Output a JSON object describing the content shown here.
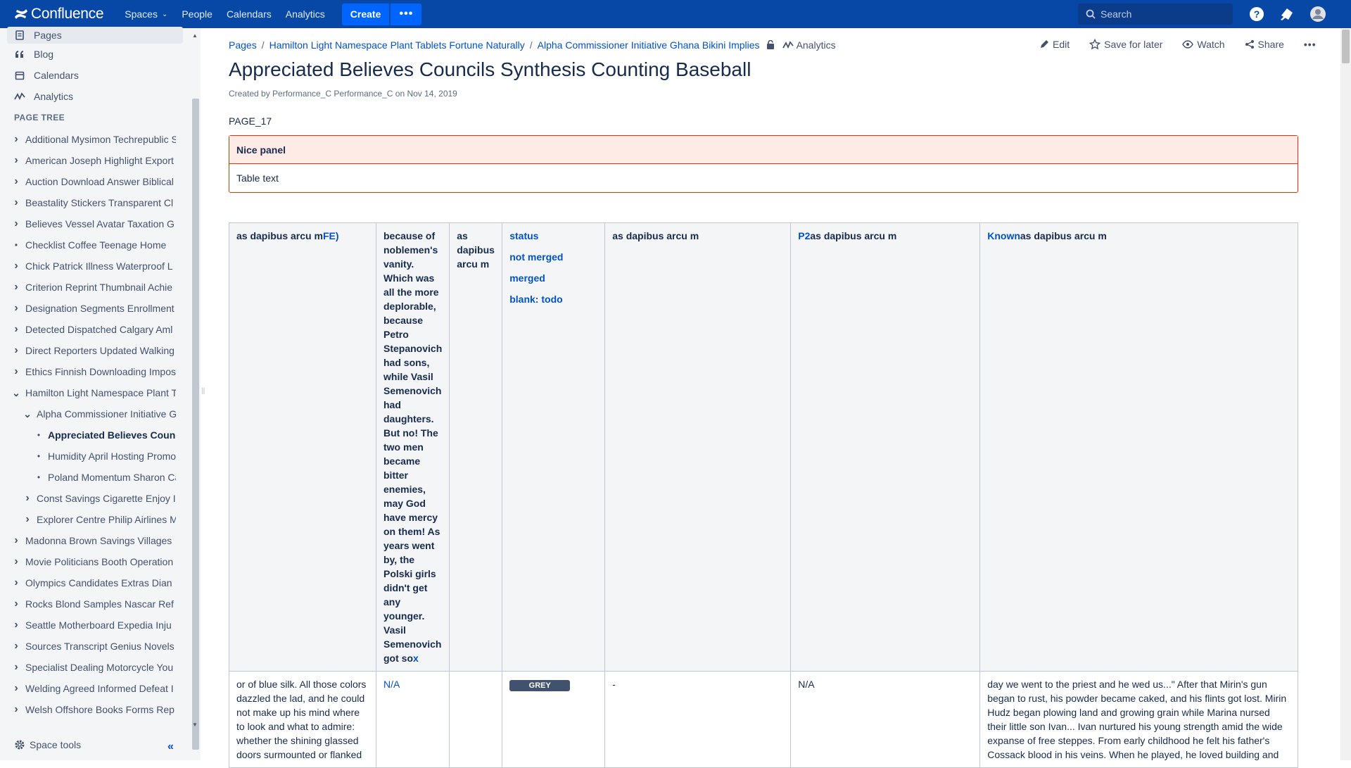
{
  "topnav": {
    "logo": "Confluence",
    "spaces": "Spaces",
    "people": "People",
    "calendars": "Calendars",
    "analytics": "Analytics",
    "create": "Create",
    "more": "•••",
    "search_placeholder": "Search"
  },
  "sidebar": {
    "top_items": [
      {
        "label": "Pages",
        "icon": "pages-icon"
      },
      {
        "label": "Blog",
        "icon": "quote-icon"
      },
      {
        "label": "Calendars",
        "icon": "calendar-icon"
      },
      {
        "label": "Analytics",
        "icon": "analytics-icon"
      }
    ],
    "tree_heading": "PAGE TREE",
    "tree": [
      {
        "label": "Additional Mysimon Techrepublic S",
        "level": 0,
        "toggle": "collapsed"
      },
      {
        "label": "American Joseph Highlight Export",
        "level": 0,
        "toggle": "collapsed"
      },
      {
        "label": "Auction Download Answer Biblical",
        "level": 0,
        "toggle": "collapsed"
      },
      {
        "label": "Beastality Stickers Transparent Cl",
        "level": 0,
        "toggle": "collapsed"
      },
      {
        "label": "Believes Vessel Avatar Taxation G",
        "level": 0,
        "toggle": "collapsed"
      },
      {
        "label": "Checklist Coffee Teenage Home",
        "level": 0,
        "toggle": "leaf"
      },
      {
        "label": "Chick Patrick Illness Waterproof L",
        "level": 0,
        "toggle": "collapsed"
      },
      {
        "label": "Criterion Reprint Thumbnail Achie",
        "level": 0,
        "toggle": "collapsed"
      },
      {
        "label": "Designation Segments Enrollment",
        "level": 0,
        "toggle": "collapsed"
      },
      {
        "label": "Detected Dispatched Calgary Aml",
        "level": 0,
        "toggle": "collapsed"
      },
      {
        "label": "Direct Reporters Updated Walking",
        "level": 0,
        "toggle": "collapsed"
      },
      {
        "label": "Ethics Finnish Downloading Impos",
        "level": 0,
        "toggle": "collapsed"
      },
      {
        "label": "Hamilton Light Namespace Plant T",
        "level": 0,
        "toggle": "expanded"
      },
      {
        "label": "Alpha Commissioner Initiative G",
        "level": 1,
        "toggle": "expanded"
      },
      {
        "label": "Appreciated Believes Coun",
        "level": 2,
        "toggle": "leaf",
        "current": true
      },
      {
        "label": "Humidity April Hosting Promo",
        "level": 2,
        "toggle": "leaf"
      },
      {
        "label": "Poland Momentum Sharon Ca",
        "level": 2,
        "toggle": "leaf"
      },
      {
        "label": "Const Savings Cigarette Enjoy I",
        "level": 1,
        "toggle": "collapsed"
      },
      {
        "label": "Explorer Centre Philip Airlines M",
        "level": 1,
        "toggle": "collapsed"
      },
      {
        "label": "Madonna Brown Savings Villages",
        "level": 0,
        "toggle": "collapsed"
      },
      {
        "label": "Movie Politicians Booth Operation",
        "level": 0,
        "toggle": "collapsed"
      },
      {
        "label": "Olympics Candidates Extras Dian",
        "level": 0,
        "toggle": "collapsed"
      },
      {
        "label": "Rocks Blond Samples Nascar Ref",
        "level": 0,
        "toggle": "collapsed"
      },
      {
        "label": "Seattle Motherboard Expedia Inju",
        "level": 0,
        "toggle": "collapsed"
      },
      {
        "label": "Sources Transcript Genius Novels",
        "level": 0,
        "toggle": "collapsed"
      },
      {
        "label": "Specialist Dealing Motorcycle You",
        "level": 0,
        "toggle": "collapsed"
      },
      {
        "label": "Welding Agreed Informed Defeat I",
        "level": 0,
        "toggle": "collapsed"
      },
      {
        "label": "Welsh Offshore Books Forms Rep",
        "level": 0,
        "toggle": "collapsed"
      }
    ],
    "space_tools": "Space tools"
  },
  "page": {
    "breadcrumbs": [
      "Pages",
      "Hamilton Light Namespace Plant Tablets Fortune Naturally",
      "Alpha Commissioner Initiative Ghana Bikini Implies"
    ],
    "analytics_link": "Analytics",
    "actions": {
      "edit": "Edit",
      "save": "Save for later",
      "watch": "Watch",
      "share": "Share"
    },
    "title": "Appreciated Believes Councils Synthesis Counting Baseball",
    "byline": "Created by Performance_C Performance_C on Nov 14, 2019",
    "page_label": "PAGE_17",
    "panel": {
      "title": "Nice panel",
      "body": "Table text"
    },
    "table": {
      "header": {
        "c1_text": "as dapibus arcu m",
        "c1_link": "FE)",
        "c2": "because of noblemen's vanity. Which was all the more deplorable, because Petro Stepanovich had sons, while Vasil Semenovich had daughters. But no! The two men became bitter enemies, may God have mercy on them! As years went by, the Polski girls didn't get any younger. Vasil Semenovich got so",
        "c2_link": "x",
        "c3": "as dapibus arcu m",
        "c4": [
          "status",
          "not merged",
          "merged",
          "blank: todo"
        ],
        "c5": "as dapibus arcu m",
        "c6_link": "P2",
        "c6_text": "as dapibus arcu m",
        "c7_link": "Known",
        "c7_text": "as dapibus arcu m"
      },
      "row1": {
        "c1": "or of blue silk. All those colors dazzled the lad, and he could not make up his mind where to look and what to admire: whether the shining glassed doors surmounted or flanked",
        "c2": "N/A",
        "c3": "",
        "c4": "GREY",
        "c5": "-",
        "c6": "N/A",
        "c7": "day we went to the priest and he wed us...\" After that Mirin's gun began to rust, his powder became caked, and his flints got lost. Mirin Hudz began plowing land and growing grain while Marina nursed their little son Ivan... Ivan nurtured his young strength amid the wide expanse of free steppes. From early childhood he felt his father's Cossack blood in his veins. When he played, he loved building and"
      }
    }
  }
}
